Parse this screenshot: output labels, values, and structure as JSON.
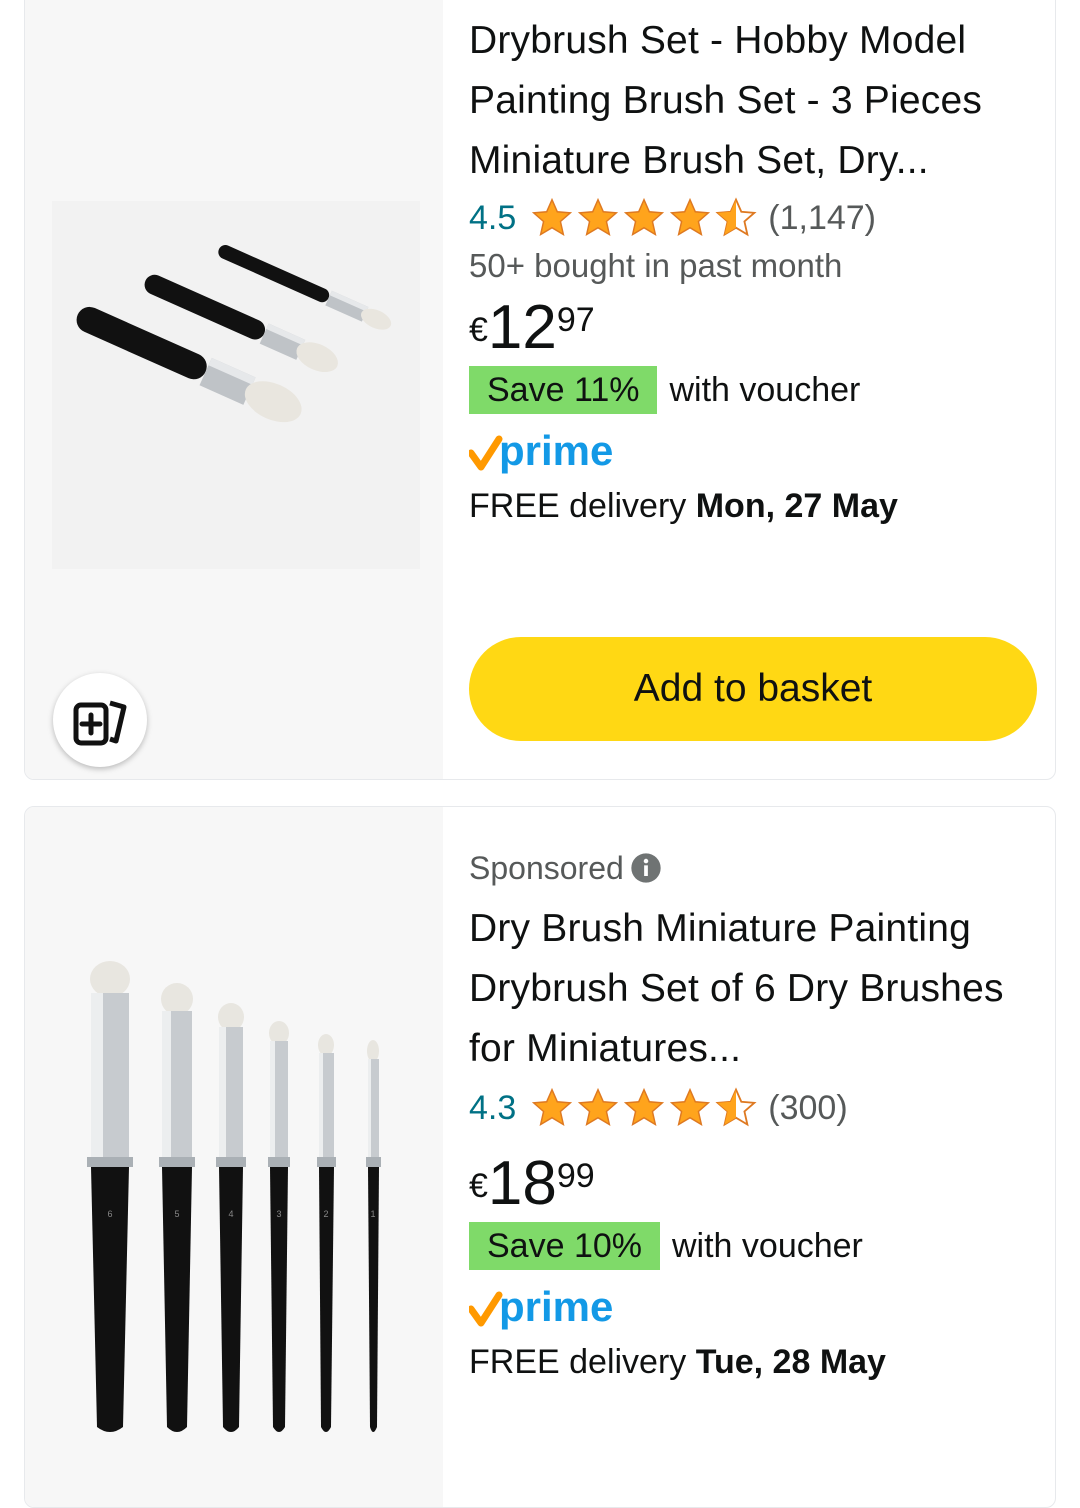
{
  "products": [
    {
      "title": "Drybrush Set - Hobby Model Painting Brush Set - 3 Pieces Miniature Brush Set, Dry...",
      "rating": "4.5",
      "rating_count": "(1,147)",
      "bought": "50+ bought in past month",
      "price_currency": "€",
      "price_whole": "12",
      "price_fraction": "97",
      "voucher_badge": "Save 11%",
      "voucher_text": "with voucher",
      "prime_label": "prime",
      "delivery_prefix": "FREE delivery",
      "delivery_date": "Mon, 27 May",
      "add_button": "Add to basket",
      "image_icon": "compare-icon"
    },
    {
      "sponsored": "Sponsored",
      "title": "Dry Brush Miniature Painting Drybrush Set of 6 Dry Brushes for Miniatures...",
      "rating": "4.3",
      "rating_count": "(300)",
      "price_currency": "€",
      "price_whole": "18",
      "price_fraction": "99",
      "voucher_badge": "Save 10%",
      "voucher_text": "with voucher",
      "prime_label": "prime",
      "delivery_prefix": "FREE delivery",
      "delivery_date": "Tue, 28 May",
      "brush_numbers": [
        "6",
        "5",
        "4",
        "3",
        "2",
        "1"
      ]
    }
  ],
  "colors": {
    "rating_link": "#007185",
    "star": "#ffa41c",
    "badge_green": "#7fda69",
    "basket_yellow": "#ffd814",
    "prime_blue": "#1399e6",
    "prime_orange": "#ff9900"
  }
}
